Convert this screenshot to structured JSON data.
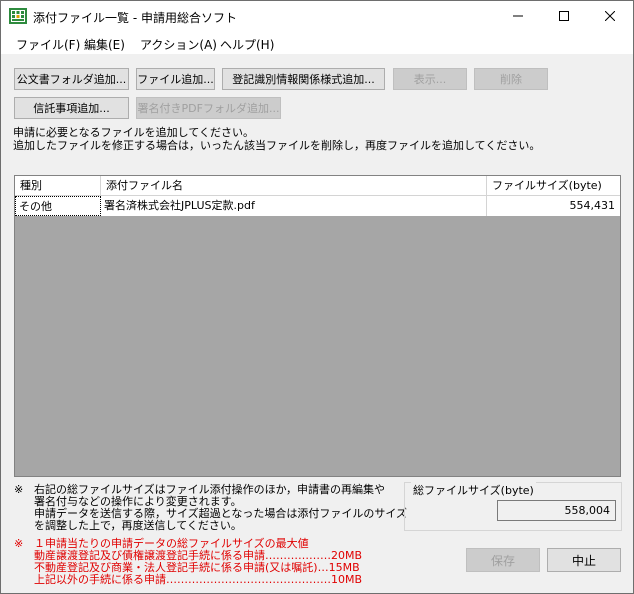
{
  "window": {
    "title": "添付ファイル一覧 - 申請用総合ソフト",
    "icon": "app-grid-icon",
    "controls": [
      "minimize-icon",
      "maximize-icon",
      "close-icon"
    ]
  },
  "menu": [
    {
      "label": "ファイル(F)"
    },
    {
      "label": "編集(E)"
    },
    {
      "label": "アクション(A)"
    },
    {
      "label": "ヘルプ(H)"
    }
  ],
  "toolbar": {
    "row1": [
      {
        "label": "公文書フォルダ追加...",
        "enabled": true
      },
      {
        "label": "ファイル追加...",
        "enabled": true
      },
      {
        "label": "登記識別情報関係様式追加...",
        "enabled": true
      },
      {
        "label": "表示...",
        "enabled": false
      },
      {
        "label": "削除",
        "enabled": false
      }
    ],
    "row2": [
      {
        "label": "信託事項追加...",
        "enabled": true
      },
      {
        "label": "署名付きPDFフォルダ追加...",
        "enabled": false
      }
    ]
  },
  "instructions": [
    "申請に必要となるファイルを追加してください。",
    "追加したファイルを修正する場合は，いったん該当ファイルを削除し，再度ファイルを追加してください。"
  ],
  "table": {
    "headers": [
      "種別",
      "添付ファイル名",
      "ファイルサイズ(byte)"
    ],
    "rows": [
      {
        "type": "その他",
        "name": "署名済株式会社JPLUS定款.pdf",
        "size": "554,431"
      }
    ]
  },
  "notes": {
    "mark": "※",
    "lines": [
      "右記の総ファイルサイズはファイル添付操作のほか，申請書の再編集や",
      "署名付与などの操作により変更されます。",
      "申請データを送信する際，サイズ超過となった場合は添付ファイルのサイズ",
      "を調整した上で，再度送信してください。"
    ],
    "red_mark": "※",
    "red_lines": [
      "１申請当たりの申請データの総ファイルサイズの最大値",
      "動産譲渡登記及び債権譲渡登記手続に係る申請………………20MB",
      "不動産登記及び商業・法人登記手続に係る申請(又は嘱託)…15MB",
      "上記以外の手続に係る申請………………………………………10MB"
    ]
  },
  "total": {
    "label": "総ファイルサイズ(byte)",
    "value": "558,004"
  },
  "footer": {
    "save_label": "保存",
    "cancel_label": "中止"
  }
}
